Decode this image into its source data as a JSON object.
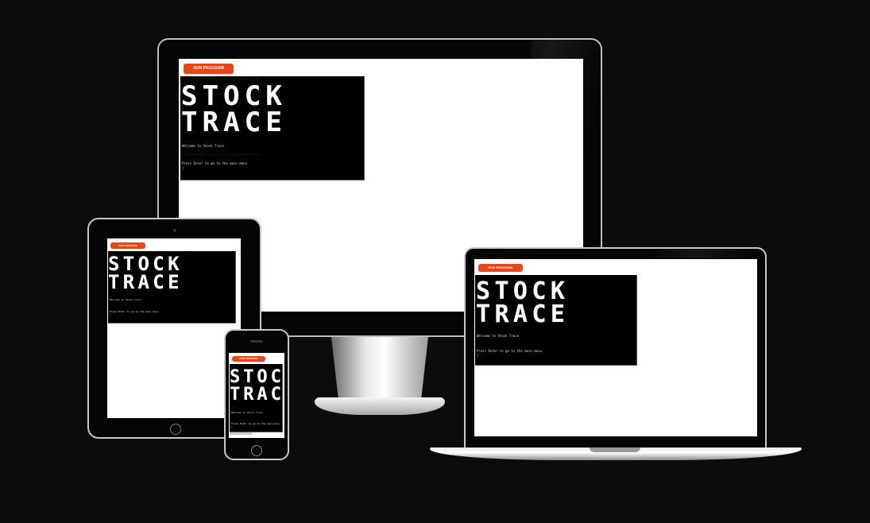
{
  "app": {
    "run_button_label": "RUN PROGRAM",
    "banner_line_1": "STOCK",
    "banner_line_2": "TRACE",
    "welcome_text": "Welcome to Stock Trace",
    "prompt_text": "Press Enter to go to the main menu",
    "cursor": "|",
    "dash_line": "------------------------------------------------------------"
  },
  "colors": {
    "background": "#0d0c0d",
    "accent_button": "#e8461a",
    "terminal": "#000000",
    "screen": "#ffffff"
  }
}
